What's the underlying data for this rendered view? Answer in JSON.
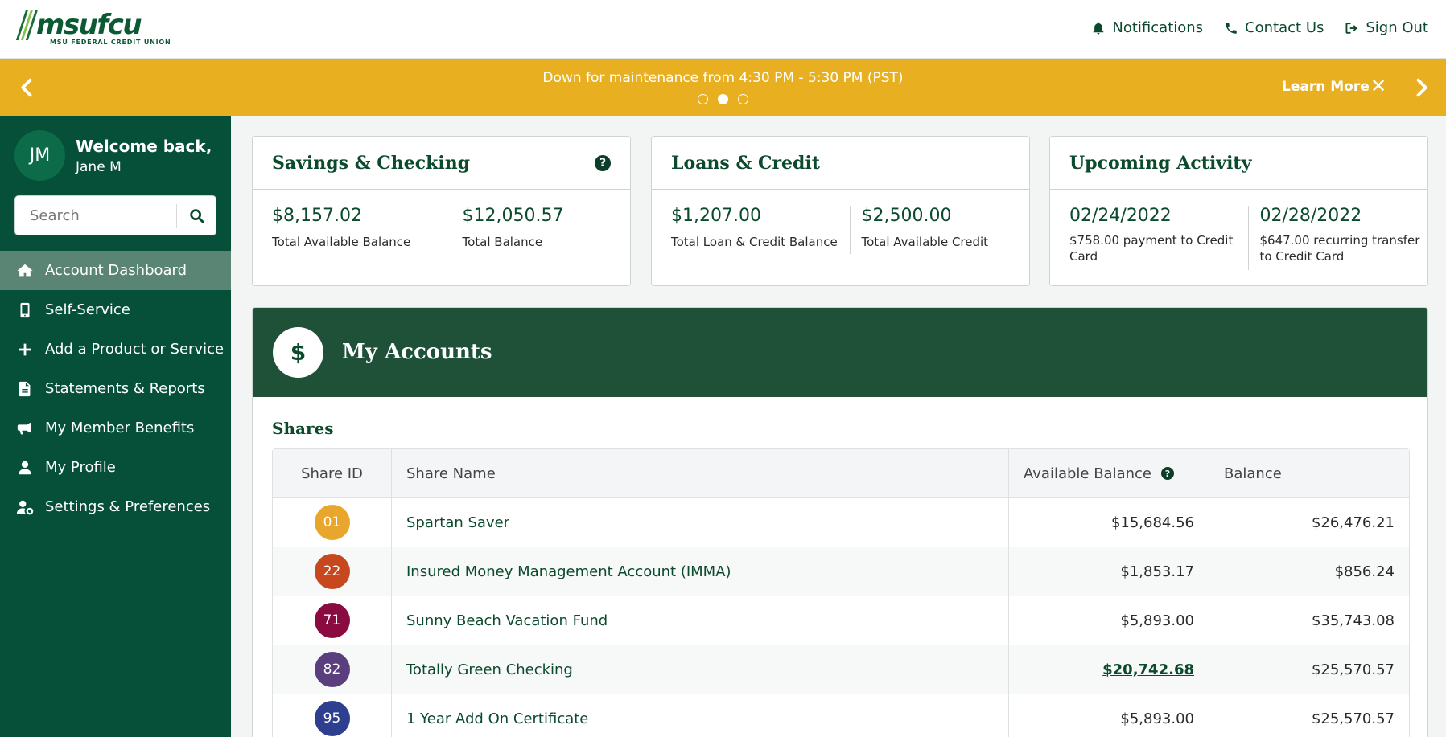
{
  "brand": {
    "logo_text": "msufcu",
    "logo_subtext": "MSU FEDERAL CREDIT UNION",
    "primary_color": "#06503a",
    "accent_color": "#e8b021"
  },
  "header": {
    "links": [
      {
        "label": "Notifications",
        "icon": "bell-icon"
      },
      {
        "label": "Contact Us",
        "icon": "phone-icon"
      },
      {
        "label": "Sign Out",
        "icon": "sign-out-icon"
      }
    ]
  },
  "banner": {
    "message": "Down for maintenance from 4:30 PM - 5:30 PM (PST)",
    "learn_more": "Learn More",
    "close": "✕",
    "slides": 3,
    "active_slide": 2
  },
  "sidebar": {
    "user": {
      "initials": "JM",
      "greeting": "Welcome back,",
      "name": "Jane M"
    },
    "search_placeholder": "Search",
    "items": [
      {
        "label": "Account Dashboard",
        "icon": "home-icon",
        "active": true
      },
      {
        "label": "Self-Service",
        "icon": "mobile-icon"
      },
      {
        "label": "Add a Product or Service",
        "icon": "plus-icon"
      },
      {
        "label": "Statements & Reports",
        "icon": "document-icon"
      },
      {
        "label": "My Member Benefits",
        "icon": "megaphone-icon"
      },
      {
        "label": "My Profile",
        "icon": "user-icon"
      },
      {
        "label": "Settings & Preferences",
        "icon": "user-cog-icon"
      }
    ]
  },
  "cards": [
    {
      "title": "Savings & Checking",
      "help": "?",
      "cols": [
        {
          "value": "$8,157.02",
          "label": "Total Available Balance"
        },
        {
          "value": "$12,050.57",
          "label": "Total Balance"
        }
      ]
    },
    {
      "title": "Loans & Credit",
      "cols": [
        {
          "value": "$1,207.00",
          "label": "Total Loan & Credit Balance"
        },
        {
          "value": "$2,500.00",
          "label": "Total Available Credit"
        }
      ]
    },
    {
      "title": "Upcoming Activity",
      "cols": [
        {
          "value": "02/24/2022",
          "label": "$758.00 payment to Credit Card"
        },
        {
          "value": "02/28/2022",
          "label": "$647.00 recurring transfer to Credit Card"
        }
      ]
    }
  ],
  "accounts": {
    "title": "My Accounts",
    "icon_symbol": "$",
    "section": "Shares",
    "columns": {
      "id": "Share ID",
      "name": "Share Name",
      "available": "Available Balance",
      "balance": "Balance",
      "help": "?"
    },
    "rows": [
      {
        "id": "01",
        "color": "#e8a62c",
        "name": "Spartan Saver",
        "available": "$15,684.56",
        "balance": "$26,476.21"
      },
      {
        "id": "22",
        "color": "#c7471f",
        "name": "Insured Money Management Account (IMMA)",
        "available": "$1,853.17",
        "balance": "$856.24"
      },
      {
        "id": "71",
        "color": "#8a0b3f",
        "name": "Sunny Beach Vacation Fund",
        "available": "$5,893.00",
        "balance": "$35,743.08"
      },
      {
        "id": "82",
        "color": "#5a3e7e",
        "name": "Totally Green Checking",
        "available": "$20,742.68",
        "balance": "$25,570.57",
        "available_link": true
      },
      {
        "id": "95",
        "color": "#2e3f8f",
        "name": "1 Year Add On Certificate",
        "available": "$5,893.00",
        "balance": "$25,570.57"
      }
    ]
  }
}
